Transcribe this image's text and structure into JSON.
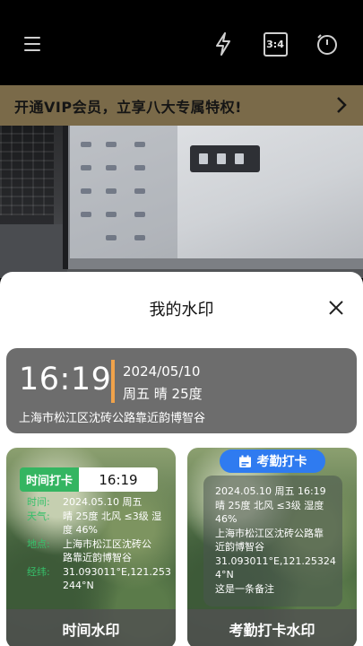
{
  "toolbar": {
    "ratio_label": "3:4"
  },
  "vip_banner": {
    "text": "开通VIP会员，立享八大专属特权!"
  },
  "sheet": {
    "title": "我的水印"
  },
  "current_watermark": {
    "time": "16:19",
    "date": "2024/05/10",
    "weekday_weather": "周五 晴 25度",
    "address": "上海市松江区沈砖公路靠近韵博智谷"
  },
  "templates": [
    {
      "name": "时间水印",
      "header_key": "时间打卡",
      "header_value": "16:19",
      "rows": [
        {
          "label": "时间:",
          "value": "2024.05.10 周五"
        },
        {
          "label": "天气:",
          "value_line1": "晴 25度 北风 ≤3级 湿",
          "value_line2": "度 46%"
        },
        {
          "label": "地点:",
          "value_line1": "上海市松江区沈砖公",
          "value_line2": "路靠近韵博智谷"
        },
        {
          "label": "经纬:",
          "value_line1": "31.093011°E,121.253",
          "value_line2": "244°N"
        }
      ]
    },
    {
      "name": "考勤打卡水印",
      "badge": "考勤打卡",
      "lines": [
        "2024.05.10 周五 16:19",
        "晴 25度 北风 ≤3级 湿度",
        "46%",
        "上海市松江区沈砖公路靠",
        "近韵博智谷",
        "31.093011°E,121.25324",
        "4°N",
        "这是一条备注"
      ]
    }
  ],
  "colors": {
    "vip_bg": "#7a6a49",
    "accent_orange": "#f0a24a",
    "green": "#34b561",
    "blue_badge": "#2f7bf0"
  }
}
